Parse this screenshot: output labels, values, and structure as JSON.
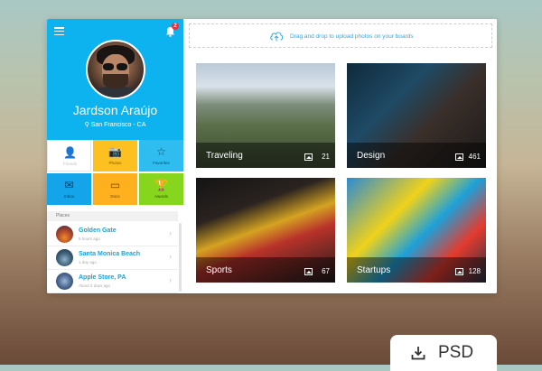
{
  "profile": {
    "name": "Jardson Araújo",
    "location": "San Francisco - CA",
    "notification_count": "2"
  },
  "tiles": [
    {
      "label": "Friends",
      "icon": "person-icon",
      "glyph": "👤",
      "color": "#ffffff",
      "text_color": "#c0c0c0"
    },
    {
      "label": "Photos",
      "icon": "camera-icon",
      "glyph": "📷",
      "color": "#fdc021",
      "text_color": "#7a5a00"
    },
    {
      "label": "Favorites",
      "icon": "star-icon",
      "glyph": "☆",
      "color": "#2fbcee",
      "text_color": "#0a4b6e"
    },
    {
      "label": "Inbox",
      "icon": "envelope-icon",
      "glyph": "✉",
      "color": "#14a4ea",
      "text_color": "#063a5a"
    },
    {
      "label": "Docs",
      "icon": "document-icon",
      "glyph": "▭",
      "color": "#ffb01f",
      "text_color": "#6b4500"
    },
    {
      "label": "Awards",
      "icon": "trophy-icon",
      "glyph": "🏆",
      "color": "#86d61d",
      "text_color": "#2d5200"
    }
  ],
  "places": {
    "heading": "Places",
    "items": [
      {
        "name": "Golden Gate",
        "time": "5 hours ago"
      },
      {
        "name": "Santa Monica Beach",
        "time": "1 day ago"
      },
      {
        "name": "Apple Store, PA",
        "time": "About 2 days ago"
      }
    ]
  },
  "upload": {
    "text": "Drag and drop to upload photos on your boards"
  },
  "boards": [
    {
      "name": "Traveling",
      "count": "21"
    },
    {
      "name": "Design",
      "count": "461"
    },
    {
      "name": "Sports",
      "count": "67"
    },
    {
      "name": "Startups",
      "count": "128"
    }
  ],
  "download": {
    "label": "PSD"
  },
  "colors": {
    "accent": "#0cb3ee",
    "link": "#1aa3dc"
  }
}
